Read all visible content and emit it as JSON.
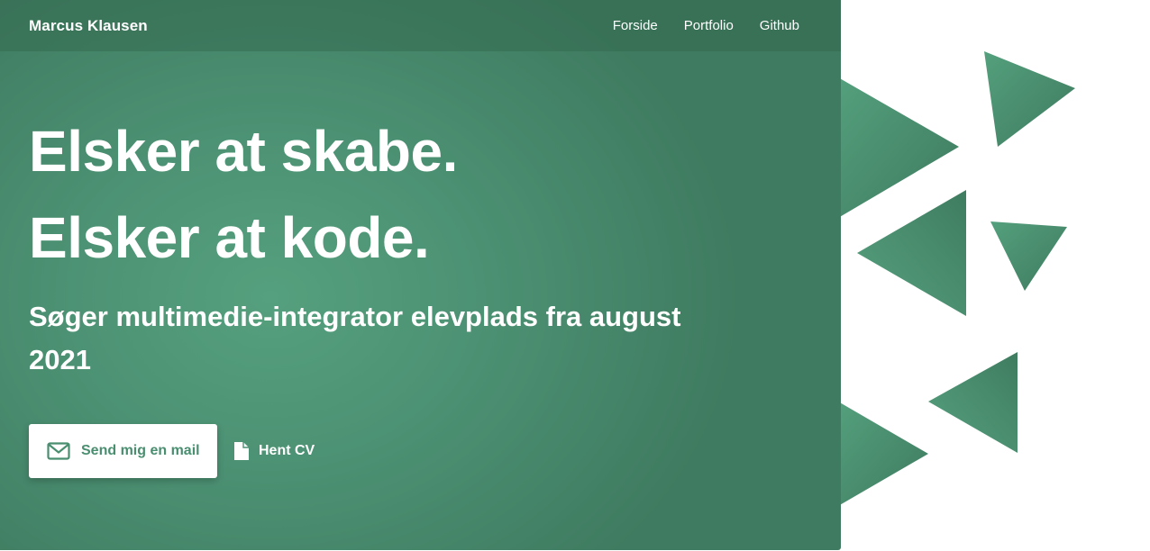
{
  "navbar": {
    "brand": "Marcus Klausen",
    "links": [
      {
        "label": "Forside"
      },
      {
        "label": "Portfolio"
      },
      {
        "label": "Github"
      }
    ]
  },
  "hero": {
    "headline_1": "Elsker at skabe.",
    "headline_2": "Elsker at kode.",
    "subtitle": "Søger multimedie-integrator elevplads fra august 2021",
    "mail_button": {
      "label": "Send mig en mail",
      "icon": "mail-icon"
    },
    "cv_button": {
      "label": "Hent CV",
      "icon": "file-icon"
    }
  },
  "colors": {
    "accent": "#4a8e70",
    "hero_light": "#55a07e",
    "hero_dark": "#3f7b60",
    "background": "#ffffff"
  }
}
